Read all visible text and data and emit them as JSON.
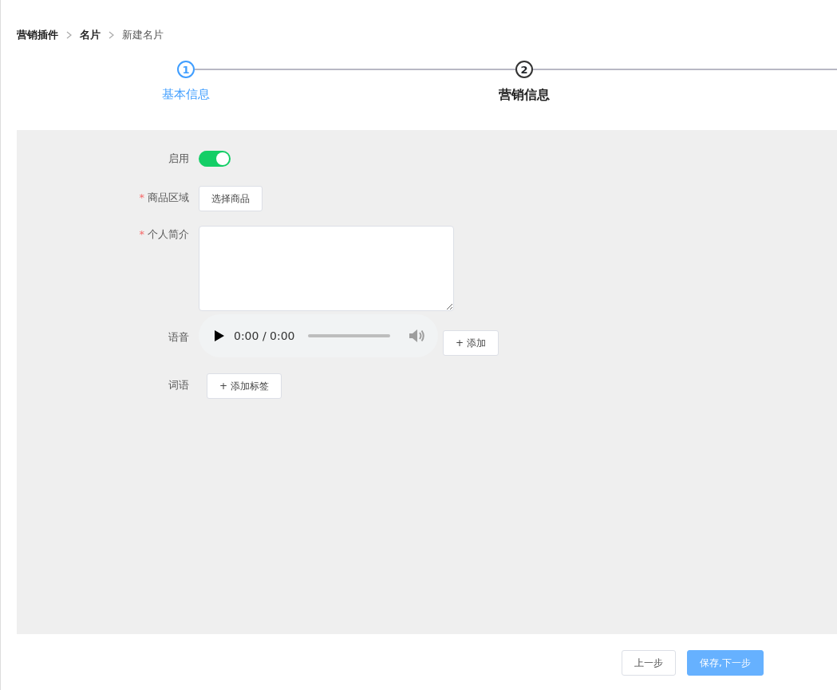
{
  "breadcrumb": [
    {
      "label": "营销插件",
      "current": false
    },
    {
      "label": "名片",
      "current": false
    },
    {
      "label": "新建名片",
      "current": true
    }
  ],
  "steps": [
    {
      "number": "1",
      "label": "基本信息",
      "finished": true,
      "active": false
    },
    {
      "number": "2",
      "label": "营销信息",
      "finished": false,
      "active": true
    }
  ],
  "form": [
    {
      "kind": "toggle",
      "label": "启用",
      "on": true
    },
    {
      "kind": "button",
      "label": "商品区域",
      "required_mark": "*",
      "button": "选择商品"
    },
    {
      "kind": "textarea",
      "label": "个人简介",
      "required_mark": "*"
    },
    {
      "kind": "audio",
      "label": "语音",
      "time": "0:00 / 0:00",
      "button": "+ 添加"
    },
    {
      "kind": "tags",
      "label": "词语",
      "button": "+ 添加标签"
    }
  ],
  "footer": {
    "buttons": [
      {
        "label": "上一步",
        "primary": false
      },
      {
        "label": "保存,下一步",
        "primary": true
      }
    ]
  }
}
